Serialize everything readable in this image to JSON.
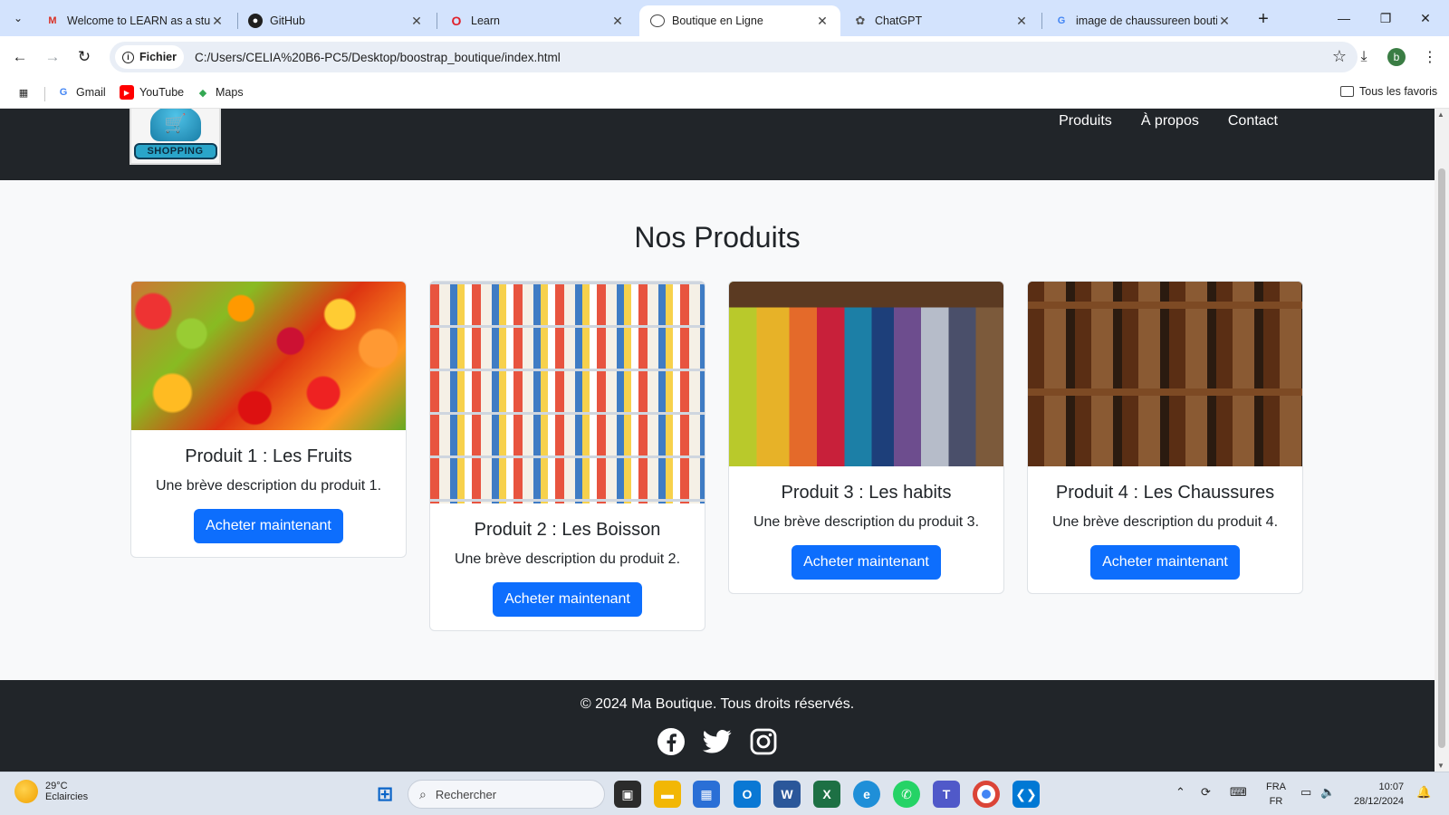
{
  "browser": {
    "tabs": [
      {
        "title": "Welcome to LEARN as a stud",
        "icon": "gmail-icon"
      },
      {
        "title": "GitHub",
        "icon": "github-icon"
      },
      {
        "title": "Learn",
        "icon": "learn-icon"
      },
      {
        "title": "Boutique en Ligne",
        "icon": "globe-icon",
        "active": true
      },
      {
        "title": "ChatGPT",
        "icon": "chatgpt-icon"
      },
      {
        "title": "image de chaussureen bouti",
        "icon": "google-icon"
      }
    ],
    "address": {
      "scheme_label": "Fichier",
      "url": "C:/Users/CELIA%20B6-PC5/Desktop/boostrap_boutique/index.html"
    },
    "profile_initial": "b",
    "bookmarks": [
      {
        "label": "Gmail",
        "icon": "google-icon"
      },
      {
        "label": "YouTube",
        "icon": "youtube-icon"
      },
      {
        "label": "Maps",
        "icon": "maps-icon"
      }
    ],
    "all_bookmarks_label": "Tous les favoris"
  },
  "site": {
    "logo_text": "SHOPPING",
    "nav_links": [
      "Produits",
      "À propos",
      "Contact"
    ],
    "section_title": "Nos Produits",
    "products": [
      {
        "title": "Produit 1 : Les Fruits",
        "description": "Une brève description du produit 1.",
        "button": "Acheter maintenant"
      },
      {
        "title": "Produit 2 : Les Boisson",
        "description": "Une brève description du produit 2.",
        "button": "Acheter maintenant"
      },
      {
        "title": "Produit 3 : Les habits",
        "description": "Une brève description du produit 3.",
        "button": "Acheter maintenant"
      },
      {
        "title": "Produit 4 : Les Chaussures",
        "description": "Une brève description du produit 4.",
        "button": "Acheter maintenant"
      }
    ],
    "footer_text": "© 2024 Ma Boutique. Tous droits réservés.",
    "socials": [
      "facebook-icon",
      "twitter-icon",
      "instagram-icon"
    ]
  },
  "taskbar": {
    "weather_temp": "29°C",
    "weather_desc": "Eclaircies",
    "search_placeholder": "Rechercher",
    "lang_top": "FRA",
    "lang_bottom": "FR",
    "time": "10:07",
    "date": "28/12/2024"
  },
  "colors": {
    "navbar": "#212529",
    "primary_button": "#0d6efd",
    "page_bg": "#f8f9fa",
    "tabstrip": "#d3e3fd"
  }
}
